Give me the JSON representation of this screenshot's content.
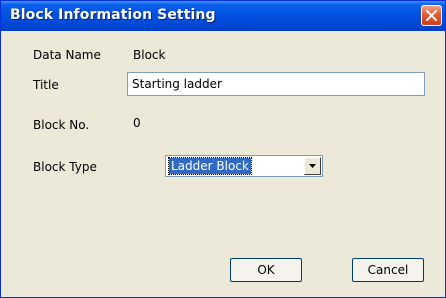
{
  "window": {
    "title": "Block Information Setting"
  },
  "fields": {
    "data_name": {
      "label": "Data Name",
      "value": "Block"
    },
    "title": {
      "label": "Title",
      "value": "Starting ladder"
    },
    "block_no": {
      "label": "Block No.",
      "value": "0"
    },
    "block_type": {
      "label": "Block Type",
      "value": "Ladder Block"
    }
  },
  "buttons": {
    "ok": "OK",
    "cancel": "Cancel"
  },
  "icons": {
    "close": "close-icon",
    "dropdown": "dropdown-arrow-icon"
  },
  "colors": {
    "titlebar": "#0054e3",
    "window_bg": "#ece9d8",
    "selection": "#316ac5",
    "close_button": "#e35a32"
  }
}
